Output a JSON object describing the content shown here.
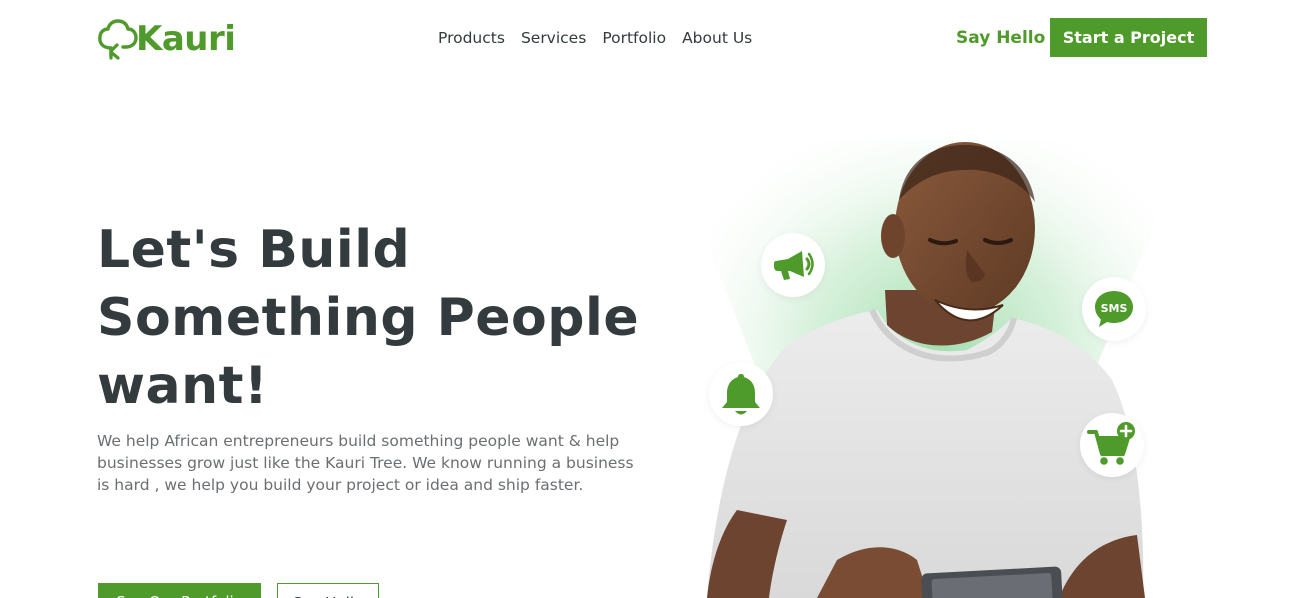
{
  "header": {
    "logo_text": "Kauri",
    "nav": [
      {
        "label": "Products"
      },
      {
        "label": "Services"
      },
      {
        "label": "Portfolio"
      },
      {
        "label": "About Us"
      }
    ],
    "say_hello": "Say Hello",
    "start_project": "Start a Project"
  },
  "hero": {
    "title_lines": [
      "Let's Build",
      "Something People",
      "want!"
    ],
    "description": "We help African entrepreneurs build something people want & help businesses grow just like the Kauri Tree. We know running a business is hard , we help you build your project or idea and ship faster.",
    "buttons": {
      "portfolio": "See Our Portfolio",
      "hello": "Say Hello"
    },
    "icons": {
      "megaphone": "megaphone-icon",
      "sms": "sms-icon",
      "bell": "bell-icon",
      "cart": "cart-add-icon"
    },
    "sms_label": "SMS"
  },
  "colors": {
    "brand_green": "#4e9a2a",
    "heading": "#333b3e",
    "body_text": "#6b6f72"
  }
}
